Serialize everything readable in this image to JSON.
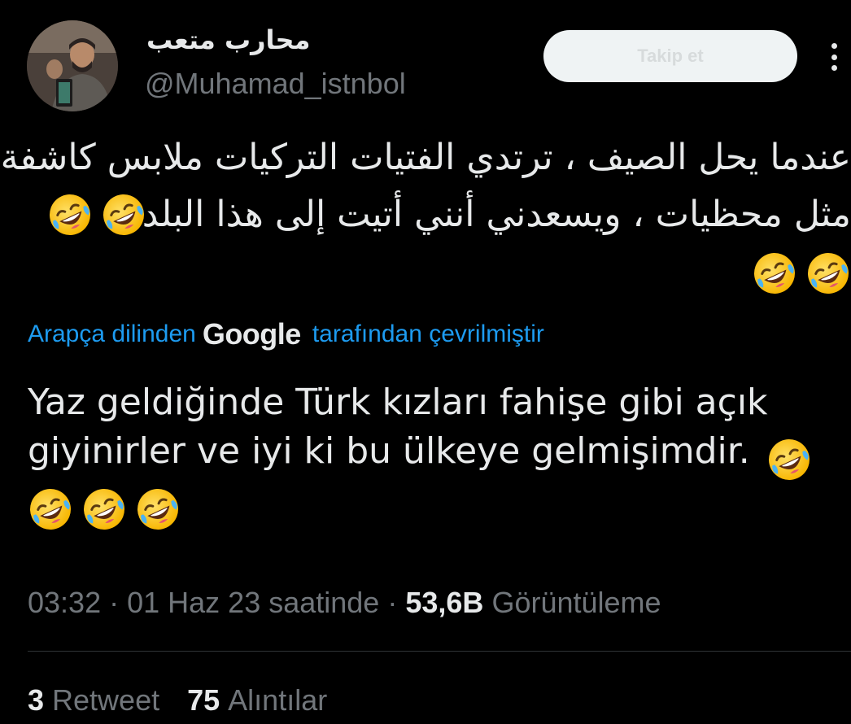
{
  "user": {
    "display_name": "محارب متعب",
    "handle": "@Muhamad_istnbol",
    "follow_label": "Takip et"
  },
  "tweet": {
    "original_line1": "عندما يحل الصيف ، ترتدي الفتيات التركيات ملابس كاشفة",
    "original_line2": "مثل محظيات ، ويسعدني أنني أتيت إلى هذا البلد.",
    "translation_prefix": "Arapça dilinden",
    "translation_provider": "Google",
    "translation_suffix": "tarafından çevrilmiştir",
    "translated_text": "Yaz geldiğinde Türk kızları fahişe gibi açık giyinirler ve iyi ki bu ülkeye gelmişimdir.",
    "emoji": "rolling-on-the-floor-laughing"
  },
  "meta": {
    "time": "03:32",
    "date": "01 Haz 23 saatinde",
    "views_count": "53,6B",
    "views_label": "Görüntüleme"
  },
  "stats": {
    "retweets_count": "3",
    "retweets_label": "Retweet",
    "quotes_count": "75",
    "quotes_label": "Alıntılar"
  }
}
